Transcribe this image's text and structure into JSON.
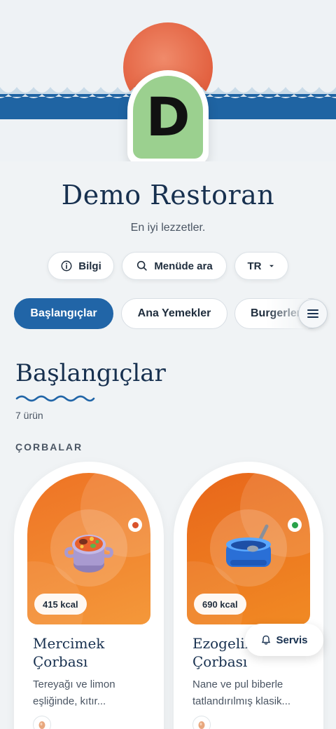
{
  "restaurant": {
    "logo_letter": "D",
    "name": "Demo Restoran",
    "tagline": "En iyi lezzetler."
  },
  "actions": {
    "info_label": "Bilgi",
    "search_label": "Menüde ara",
    "language_label": "TR"
  },
  "category_tabs": [
    {
      "label": "Başlangıçlar",
      "active": true
    },
    {
      "label": "Ana Yemekler",
      "active": false
    },
    {
      "label": "Burgerler",
      "active": false
    }
  ],
  "section": {
    "title": "Başlangıçlar",
    "count": "7 ürün",
    "subcategory": "ÇORBALAR"
  },
  "items": [
    {
      "name": "Mercimek Çorbası",
      "description": "Tereyağı ve limon eşliğinde, kıtır...",
      "kcal": "415 kcal",
      "icon": "soup-pot-icon",
      "diet_dot_color": "#d9532c",
      "image_color": "#f08a2a"
    },
    {
      "name": "Ezogelin Çorbası",
      "description": "Nane ve pul biberle tatlandırılmış klasik...",
      "kcal": "690 kcal",
      "icon": "bowl-icon",
      "diet_dot_color": "#2aa24a",
      "image_color": "#ee7a1c"
    }
  ],
  "service_button": {
    "label": "Servis"
  },
  "colors": {
    "accent": "#2165a7",
    "sun": "#e2603f",
    "logo_bg": "#9bd08f",
    "card_orange": "#f08a2a"
  }
}
